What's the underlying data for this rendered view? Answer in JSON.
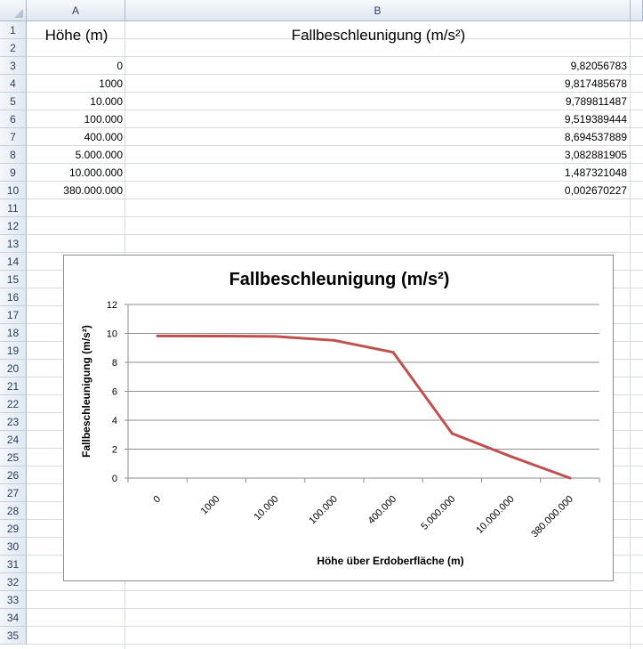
{
  "sheet": {
    "columns": [
      "A",
      "B"
    ],
    "rows": [
      "1",
      "2",
      "3",
      "4",
      "5",
      "6",
      "7",
      "8",
      "9",
      "10",
      "11",
      "12",
      "13",
      "14",
      "15",
      "16",
      "17",
      "18",
      "19",
      "20",
      "21",
      "22",
      "23",
      "24",
      "25",
      "26",
      "27",
      "28",
      "29",
      "30",
      "31",
      "32",
      "33",
      "34",
      "35"
    ],
    "header_a": "Höhe (m)",
    "header_b": "Fallbeschleunigung (m/s²)",
    "data": [
      {
        "a": "0",
        "b": "9,82056783"
      },
      {
        "a": "1000",
        "b": "9,817485678"
      },
      {
        "a": "10.000",
        "b": "9,789811487"
      },
      {
        "a": "100.000",
        "b": "9,519389444"
      },
      {
        "a": "400.000",
        "b": "8,694537889"
      },
      {
        "a": "5.000.000",
        "b": "3,082881905"
      },
      {
        "a": "10.000.000",
        "b": "1,487321048"
      },
      {
        "a": "380.000.000",
        "b": "0,002670227"
      }
    ]
  },
  "chart_data": {
    "type": "line",
    "title": "Fallbeschleunigung (m/s²)",
    "xlabel": "Höhe über Erdoberfläche (m)",
    "ylabel": "Fallbeschleunigung (m/s²)",
    "categories": [
      "0",
      "1000",
      "10.000",
      "100.000",
      "400.000",
      "5.000.000",
      "10.000.000",
      "380.000.000"
    ],
    "series": [
      {
        "values": [
          9.82056783,
          9.817485678,
          9.789811487,
          9.519389444,
          8.694537889,
          3.082881905,
          1.487321048,
          0.002670227
        ],
        "color": "#c0504d"
      }
    ],
    "ylim": [
      0,
      12
    ],
    "yticks": [
      0,
      2,
      4,
      6,
      8,
      10,
      12
    ],
    "grid": true
  }
}
